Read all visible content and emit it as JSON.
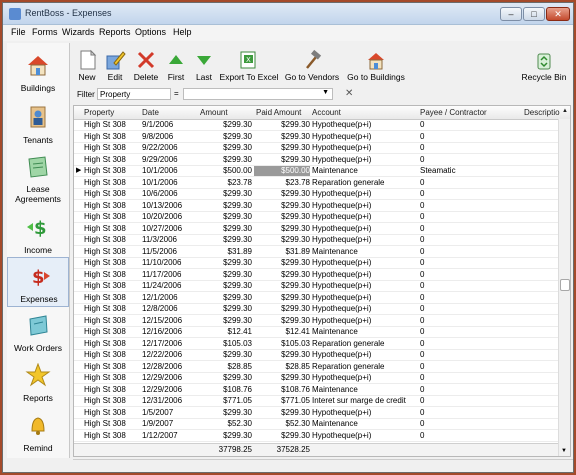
{
  "window": {
    "title": "RentBoss - Expenses"
  },
  "menu": [
    "File",
    "Forms",
    "Wizards",
    "Reports",
    "Options",
    "Help"
  ],
  "sidebar": [
    {
      "label": "Buildings"
    },
    {
      "label": "Tenants"
    },
    {
      "label": "Lease\nAgreements"
    },
    {
      "label": "Income"
    },
    {
      "label": "Expenses"
    },
    {
      "label": "Work Orders"
    },
    {
      "label": "Reports"
    },
    {
      "label": "Remind"
    }
  ],
  "toolbar": {
    "new": "New",
    "edit": "Edit",
    "delete": "Delete",
    "first": "First",
    "last": "Last",
    "export": "Export To Excel",
    "vendors": "Go to Vendors",
    "buildings": "Go to Buildings",
    "recycle": "Recycle Bin"
  },
  "filter": {
    "label": "Filter",
    "field": "Property",
    "operator": "=",
    "value": ""
  },
  "grid": {
    "columns": [
      "Property",
      "Date",
      "Amount",
      "Paid Amount",
      "Account",
      "Payee / Contractor",
      "Descriptio"
    ],
    "rows": [
      [
        "High St 308",
        "9/1/2006",
        "$299.30",
        "$299.30",
        "Hypotheque(p+i)",
        "0"
      ],
      [
        "High St 308",
        "9/8/2006",
        "$299.30",
        "$299.30",
        "Hypotheque(p+i)",
        "0"
      ],
      [
        "High St 308",
        "9/22/2006",
        "$299.30",
        "$299.30",
        "Hypotheque(p+i)",
        "0"
      ],
      [
        "High St 308",
        "9/29/2006",
        "$299.30",
        "$299.30",
        "Hypotheque(p+i)",
        "0"
      ],
      [
        "High St 308",
        "10/1/2006",
        "$500.00",
        "$500.00",
        "Maintenance",
        "Steamatic"
      ],
      [
        "High St 308",
        "10/1/2006",
        "$23.78",
        "$23.78",
        "Reparation generale",
        "0"
      ],
      [
        "High St 308",
        "10/6/2006",
        "$299.30",
        "$299.30",
        "Hypotheque(p+i)",
        "0"
      ],
      [
        "High St 308",
        "10/13/2006",
        "$299.30",
        "$299.30",
        "Hypotheque(p+i)",
        "0"
      ],
      [
        "High St 308",
        "10/20/2006",
        "$299.30",
        "$299.30",
        "Hypotheque(p+i)",
        "0"
      ],
      [
        "High St 308",
        "10/27/2006",
        "$299.30",
        "$299.30",
        "Hypotheque(p+i)",
        "0"
      ],
      [
        "High St 308",
        "11/3/2006",
        "$299.30",
        "$299.30",
        "Hypotheque(p+i)",
        "0"
      ],
      [
        "High St 308",
        "11/5/2006",
        "$31.89",
        "$31.89",
        "Maintenance",
        "0"
      ],
      [
        "High St 308",
        "11/10/2006",
        "$299.30",
        "$299.30",
        "Hypotheque(p+i)",
        "0"
      ],
      [
        "High St 308",
        "11/17/2006",
        "$299.30",
        "$299.30",
        "Hypotheque(p+i)",
        "0"
      ],
      [
        "High St 308",
        "11/24/2006",
        "$299.30",
        "$299.30",
        "Hypotheque(p+i)",
        "0"
      ],
      [
        "High St 308",
        "12/1/2006",
        "$299.30",
        "$299.30",
        "Hypotheque(p+i)",
        "0"
      ],
      [
        "High St 308",
        "12/8/2006",
        "$299.30",
        "$299.30",
        "Hypotheque(p+i)",
        "0"
      ],
      [
        "High St 308",
        "12/15/2006",
        "$299.30",
        "$299.30",
        "Hypotheque(p+i)",
        "0"
      ],
      [
        "High St 308",
        "12/16/2006",
        "$12.41",
        "$12.41",
        "Maintenance",
        "0"
      ],
      [
        "High St 308",
        "12/17/2006",
        "$105.03",
        "$105.03",
        "Reparation generale",
        "0"
      ],
      [
        "High St 308",
        "12/22/2006",
        "$299.30",
        "$299.30",
        "Hypotheque(p+i)",
        "0"
      ],
      [
        "High St 308",
        "12/28/2006",
        "$28.85",
        "$28.85",
        "Reparation generale",
        "0"
      ],
      [
        "High St 308",
        "12/29/2006",
        "$299.30",
        "$299.30",
        "Hypotheque(p+i)",
        "0"
      ],
      [
        "High St 308",
        "12/29/2006",
        "$108.76",
        "$108.76",
        "Maintenance",
        "0"
      ],
      [
        "High St 308",
        "12/31/2006",
        "$771.05",
        "$771.05",
        "Interet sur marge de credit",
        "0"
      ],
      [
        "High St 308",
        "1/5/2007",
        "$299.30",
        "$299.30",
        "Hypotheque(p+i)",
        "0"
      ],
      [
        "High St 308",
        "1/9/2007",
        "$52.30",
        "$52.30",
        "Maintenance",
        "0"
      ],
      [
        "High St 308",
        "1/12/2007",
        "$299.30",
        "$299.30",
        "Hypotheque(p+i)",
        "0"
      ]
    ],
    "selected_row": 4,
    "totals": {
      "amount": "37798.25",
      "paid": "37528.25"
    }
  }
}
